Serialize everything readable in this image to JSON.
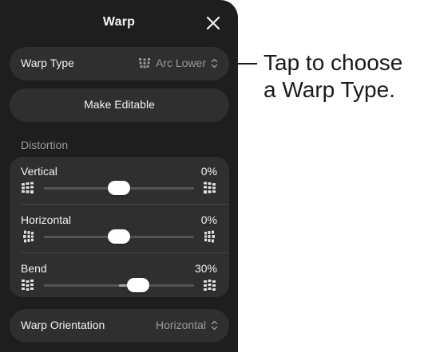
{
  "panel": {
    "title": "Warp"
  },
  "warp_type": {
    "label": "Warp Type",
    "value": "Arc Lower"
  },
  "make_editable": {
    "label": "Make Editable"
  },
  "distortion": {
    "section_label": "Distortion",
    "sliders": [
      {
        "name": "Vertical",
        "value_text": "0%",
        "value": 0,
        "min": -100,
        "max": 100
      },
      {
        "name": "Horizontal",
        "value_text": "0%",
        "value": 0,
        "min": -100,
        "max": 100
      },
      {
        "name": "Bend",
        "value_text": "30%",
        "value": 30,
        "min": -100,
        "max": 100
      }
    ]
  },
  "warp_orientation": {
    "label": "Warp Orientation",
    "value": "Horizontal"
  },
  "callout": {
    "line1": "Tap to choose",
    "line2": "a Warp Type."
  },
  "icons": {
    "close": "close-icon",
    "warp_type": "warp-arc-icon",
    "chevron": "chevron-up-down-icon"
  },
  "colors": {
    "panel_bg": "#1e1e1e",
    "row_bg": "#2f2f2f",
    "text": "#f2f2f2",
    "secondary_text": "#9a9a9a"
  }
}
